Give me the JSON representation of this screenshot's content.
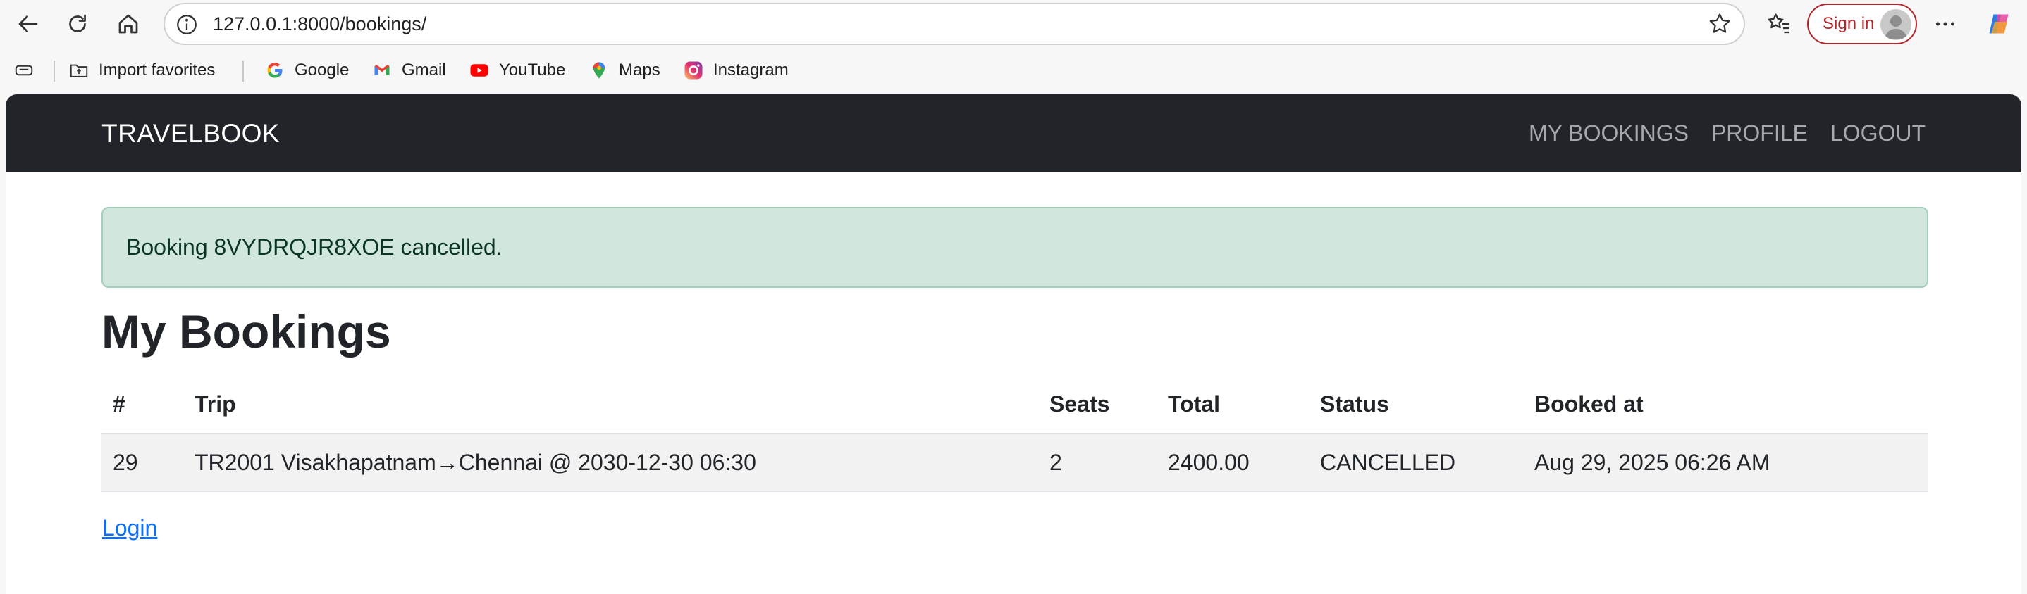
{
  "browser": {
    "url": "127.0.0.1:8000/bookings/",
    "signin_label": "Sign in",
    "icons": [
      "back-icon",
      "refresh-icon",
      "home-icon",
      "info-icon",
      "star-icon",
      "favorites-icon",
      "more-icon",
      "copilot-icon"
    ]
  },
  "bookmarks": {
    "import": "Import favorites",
    "google": "Google",
    "gmail": "Gmail",
    "youtube": "YouTube",
    "maps": "Maps",
    "instagram": "Instagram"
  },
  "nav": {
    "brand": "TRAVELBOOK",
    "links": [
      "MY BOOKINGS",
      "PROFILE",
      "LOGOUT"
    ]
  },
  "alert": {
    "message": "Booking 8VYDRQJR8XOE cancelled."
  },
  "page": {
    "title": "My Bookings",
    "login_link": "Login"
  },
  "table": {
    "headers": [
      "#",
      "Trip",
      "Seats",
      "Total",
      "Status",
      "Booked at"
    ],
    "rows": [
      [
        "29",
        "TR2001 Visakhapatnam→Chennai @ 2030-12-30 06:30",
        "2",
        "2400.00",
        "CANCELLED",
        "Aug 29, 2025 06:26 AM"
      ]
    ]
  },
  "colors": {
    "navbar_bg": "#212529",
    "alert_bg": "#d1e7dd",
    "alert_border": "#a3cfbb",
    "alert_text": "#0a3622",
    "link": "#0d6efd",
    "signin": "#b3262b"
  }
}
